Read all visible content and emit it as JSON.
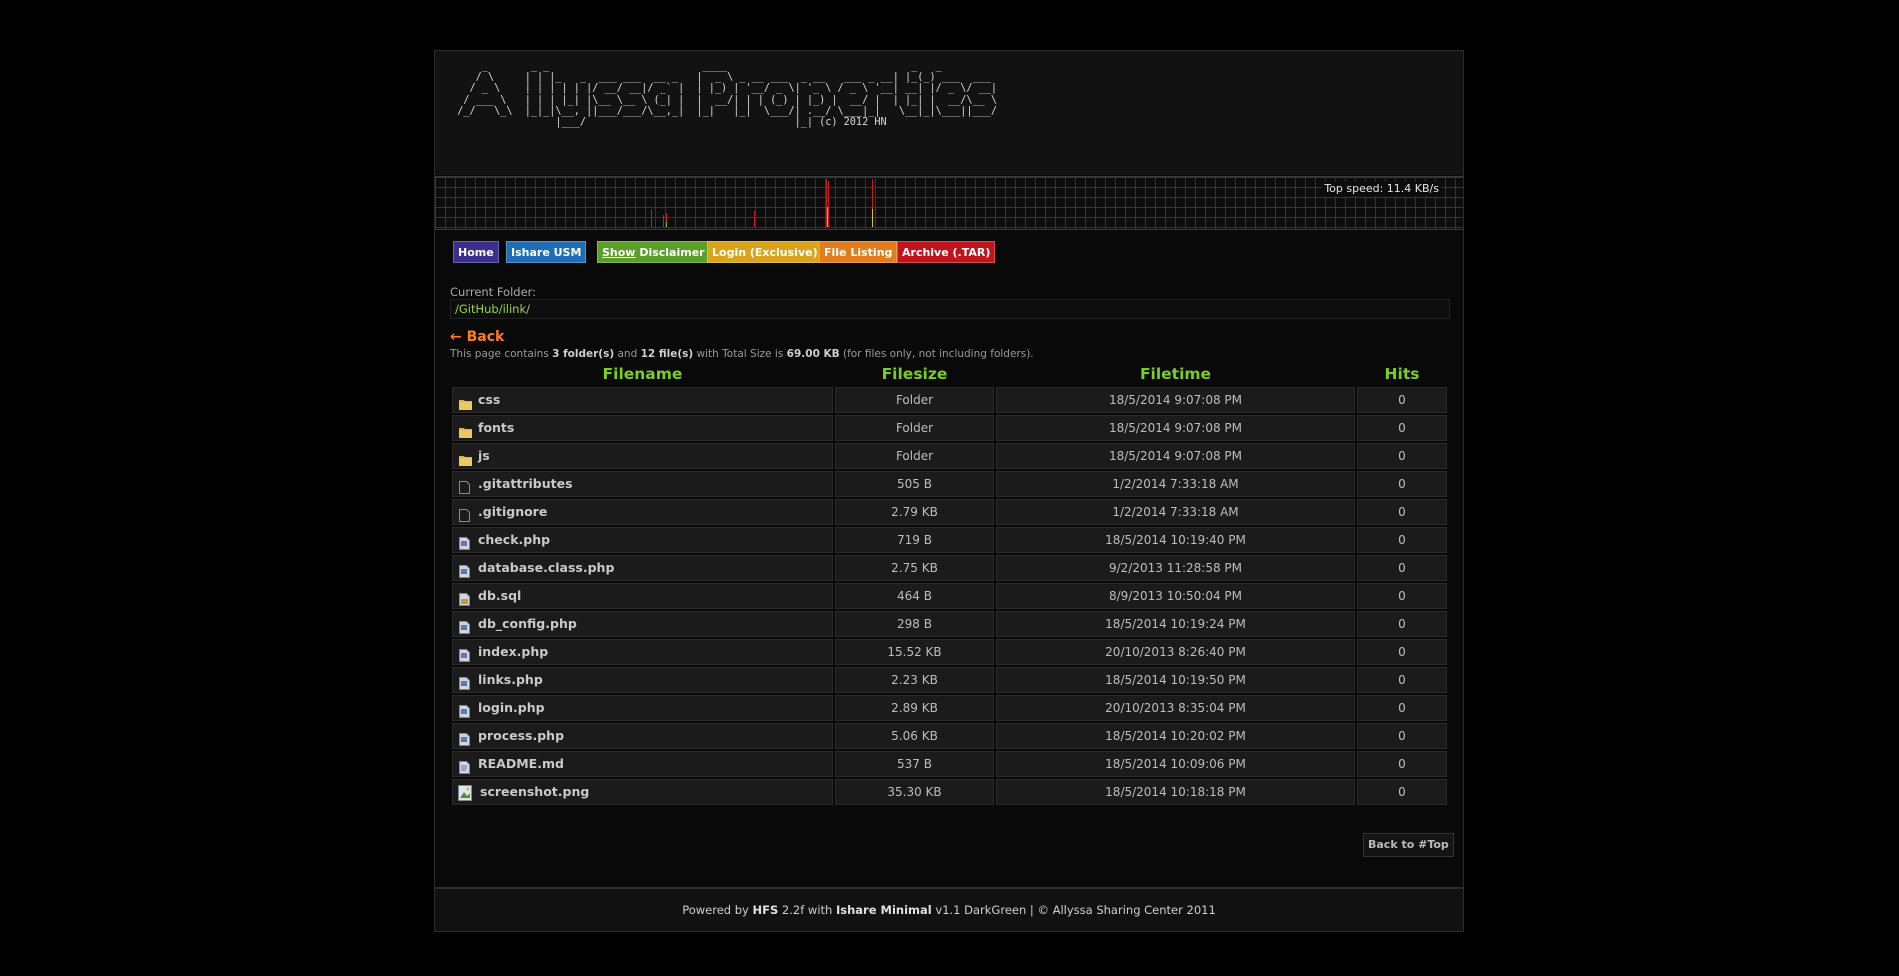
{
  "banner": {
    "ascii_art": "      _       _ _                         ____                              _   _           \n     / \\     | | |_   _  ___ ___  __ _   |  _ \\ _ __ ___  _ __   ___ _ __| |_(_) ___  ___ \n    / _ \\    | | | | | |/ __/ __|/ _` |  | |_) | '__/ _ \\| '_ \\ / _ \\ '__| __| |/ _ \\/ __|\n   / ___ \\   | | | |_| |\\__ \\__ \\ (_| |  |  __/| | | (_) | |_) |  __/ |  | |_| |  __/\\__ \\\n  /_/   \\_\\  |_|_|\\__, ||___/___/\\__,_|  |_|   |_|  \\___/| .__/ \\___|_|   \\__|_|\\___||___/\n                  |___/                                  |_| (c) 2012 HN",
    "top_speed": "Top speed: 11.4 KB/s"
  },
  "nav": [
    {
      "label": "Home",
      "color": "#3a2f8a"
    },
    {
      "label": "Ishare USM",
      "color": "#1f6eb5"
    },
    {
      "label_underlined": "Show",
      "label": " Disclaimer",
      "color": "#5b9e28"
    },
    {
      "label": "Login (Exclusive)",
      "color": "#d9a41a"
    },
    {
      "label": "File Listing",
      "color": "#e27d1d"
    },
    {
      "label": "Archive (.TAR)",
      "color": "#c1141d"
    }
  ],
  "folder": {
    "label": "Current Folder:",
    "path": "/GitHub/ilink/"
  },
  "back_label": "← Back",
  "summary": {
    "prefix": "This page contains ",
    "folders": "3 folder(s)",
    "and": " and ",
    "files": "12 file(s)",
    "mid": " with Total Size is ",
    "size": "69.00 KB",
    "suffix": " (for files only, not including folders)."
  },
  "table": {
    "headers": [
      "Filename",
      "Filesize",
      "Filetime",
      "Hits"
    ],
    "rows": [
      {
        "name": "css",
        "size": "Folder",
        "time": "18/5/2014 9:07:08 PM",
        "hits": "0",
        "icon": "folder-icon"
      },
      {
        "name": "fonts",
        "size": "Folder",
        "time": "18/5/2014 9:07:08 PM",
        "hits": "0",
        "icon": "folder-icon"
      },
      {
        "name": "js",
        "size": "Folder",
        "time": "18/5/2014 9:07:08 PM",
        "hits": "0",
        "icon": "folder-icon"
      },
      {
        "name": ".gitattributes",
        "size": "505 B",
        "time": "1/2/2014 7:33:18 AM",
        "hits": "0",
        "icon": "blank-file-icon"
      },
      {
        "name": ".gitignore",
        "size": "2.79 KB",
        "time": "1/2/2014 7:33:18 AM",
        "hits": "0",
        "icon": "blank-file-icon"
      },
      {
        "name": "check.php",
        "size": "719 B",
        "time": "18/5/2014 10:19:40 PM",
        "hits": "0",
        "icon": "php-file-icon"
      },
      {
        "name": "database.class.php",
        "size": "2.75 KB",
        "time": "9/2/2013 11:28:58 PM",
        "hits": "0",
        "icon": "php-file-icon"
      },
      {
        "name": "db.sql",
        "size": "464 B",
        "time": "8/9/2013 10:50:04 PM",
        "hits": "0",
        "icon": "sql-file-icon"
      },
      {
        "name": "db_config.php",
        "size": "298 B",
        "time": "18/5/2014 10:19:24 PM",
        "hits": "0",
        "icon": "php-file-icon"
      },
      {
        "name": "index.php",
        "size": "15.52 KB",
        "time": "20/10/2013 8:26:40 PM",
        "hits": "0",
        "icon": "php-file-icon"
      },
      {
        "name": "links.php",
        "size": "2.23 KB",
        "time": "18/5/2014 10:19:50 PM",
        "hits": "0",
        "icon": "php-file-icon"
      },
      {
        "name": "login.php",
        "size": "2.89 KB",
        "time": "20/10/2013 8:35:04 PM",
        "hits": "0",
        "icon": "php-file-icon"
      },
      {
        "name": "process.php",
        "size": "5.06 KB",
        "time": "18/5/2014 10:20:02 PM",
        "hits": "0",
        "icon": "php-file-icon"
      },
      {
        "name": "README.md",
        "size": "537 B",
        "time": "18/5/2014 10:09:06 PM",
        "hits": "0",
        "icon": "text-file-icon"
      },
      {
        "name": "screenshot.png",
        "size": "35.30 KB",
        "time": "18/5/2014 10:18:18 PM",
        "hits": "0",
        "icon": "image-file-icon"
      }
    ]
  },
  "back_to_top": "Back to #Top",
  "footer": {
    "p1": "Powered by ",
    "b1": "HFS",
    "p2": " 2.2f with ",
    "b2": "Ishare Minimal",
    "p3": " v1.1 DarkGreen | © Allyssa Sharing Center 2011"
  }
}
